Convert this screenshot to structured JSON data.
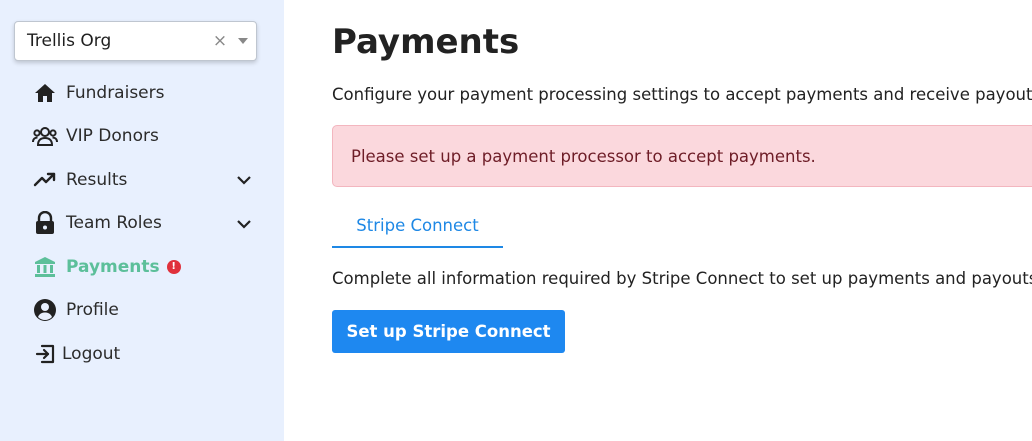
{
  "org_select": {
    "value": "Trellis Org",
    "clear_symbol": "×"
  },
  "sidebar": {
    "items": [
      {
        "label": "Fundraisers",
        "icon": "home-icon"
      },
      {
        "label": "VIP Donors",
        "icon": "users-icon"
      },
      {
        "label": "Results",
        "icon": "trending-up-icon",
        "expandable": true
      },
      {
        "label": "Team Roles",
        "icon": "lock-icon",
        "expandable": true
      },
      {
        "label": "Payments",
        "icon": "bank-icon",
        "active": true,
        "alert": "!"
      },
      {
        "label": "Profile",
        "icon": "user-circle-icon"
      },
      {
        "label": "Logout",
        "icon": "logout-icon"
      }
    ]
  },
  "colors": {
    "sidebar_bg": "#e8f0fe",
    "active": "#5cbf9a",
    "accent": "#1e88e5",
    "alert_bg": "#fbd8dd",
    "alert_text": "#6e1d27",
    "badge": "#e0313c"
  },
  "main": {
    "title": "Payments",
    "description": "Configure your payment processing settings to accept payments and receive payouts.",
    "alert": "Please set up a payment processor to accept payments.",
    "tab_label": "Stripe Connect",
    "complete_text": "Complete all information required by Stripe Connect to set up payments and payouts. This",
    "button_label": "Set up Stripe Connect"
  }
}
